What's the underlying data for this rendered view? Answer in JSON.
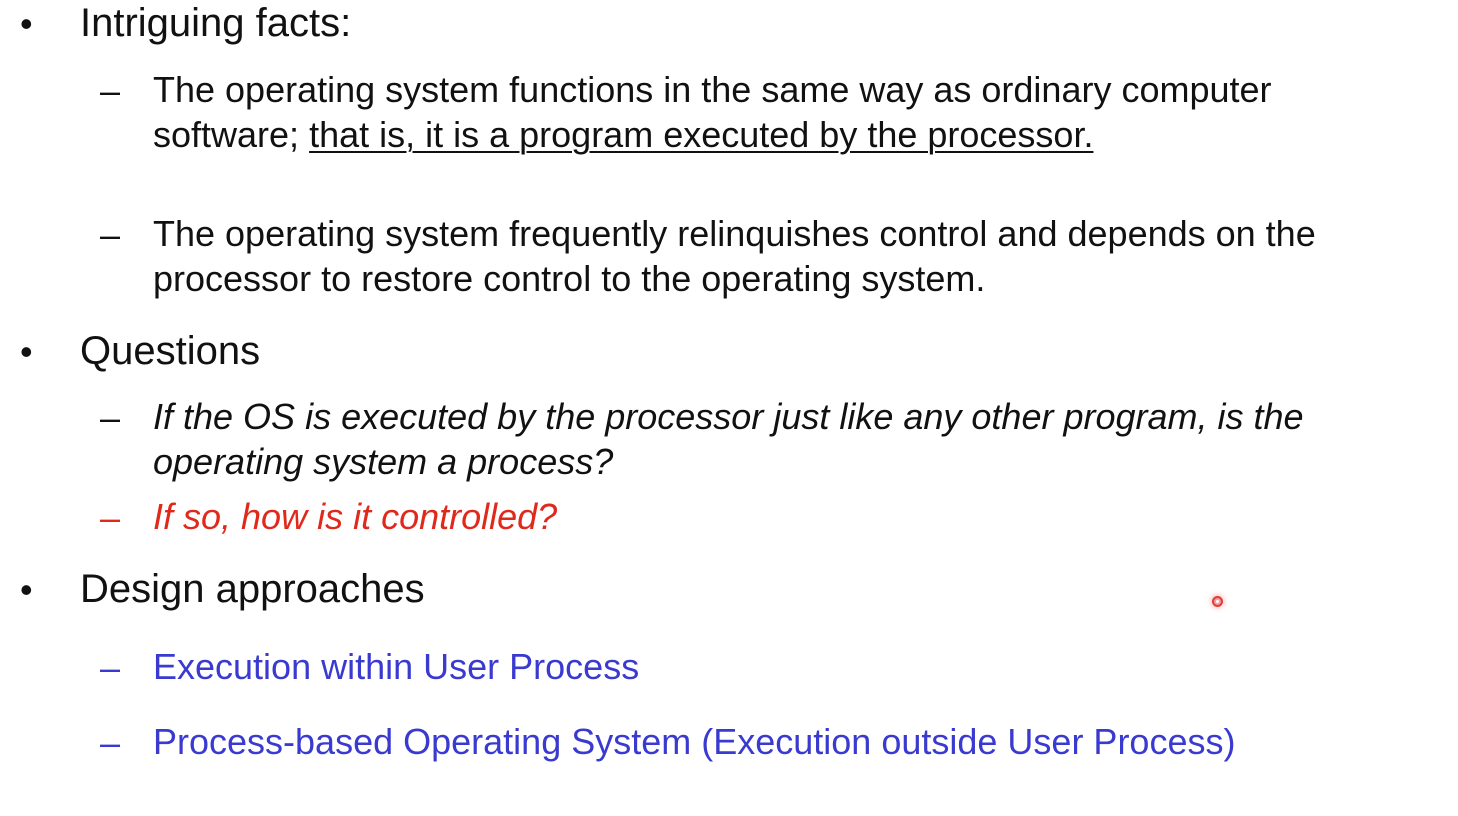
{
  "sections": [
    {
      "heading": "Intriguing facts:",
      "items": [
        {
          "part1": "The operating system functions in the same way as ordinary computer software; ",
          "part2_underlined": "that is, it is a program executed by the processor."
        },
        {
          "text": "The operating system frequently relinquishes control and depends on the processor to restore control to the operating system."
        }
      ]
    },
    {
      "heading": "Questions",
      "items": [
        {
          "text": "If the OS is executed by the processor just like any other program, is the operating system a process?"
        },
        {
          "text": "If so, how is it controlled?"
        }
      ]
    },
    {
      "heading": "Design approaches",
      "items": [
        {
          "text": "Execution within User Process"
        },
        {
          "text": "Process-based Operating System (Execution outside User Process)"
        }
      ]
    }
  ],
  "glyphs": {
    "bullet": "•",
    "dash": "–"
  },
  "colors": {
    "text": "#111111",
    "highlight_red": "#e0281b",
    "link_blue": "#3a3ad0",
    "pointer": "#e83a3a"
  }
}
